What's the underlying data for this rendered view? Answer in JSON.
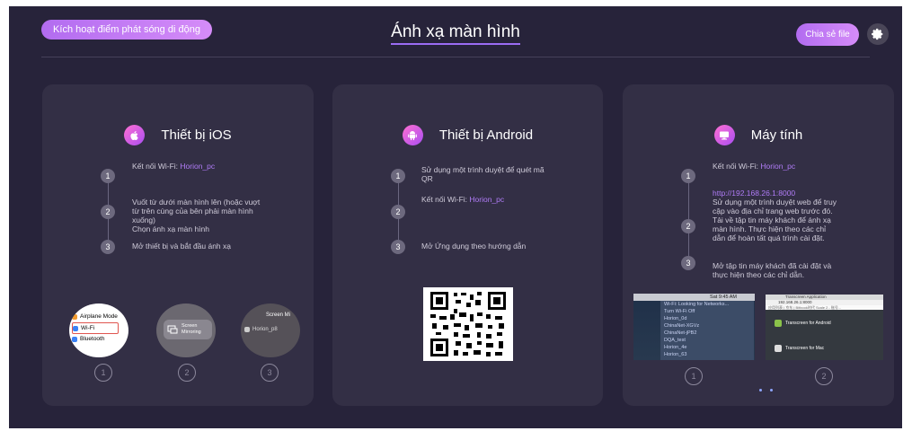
{
  "header": {
    "hotspot_label": "Kích hoạt điểm phát sóng di động",
    "title": "Ánh xạ màn hình",
    "share_label": "Chia sẻ file",
    "settings_icon": "gear-icon"
  },
  "ios": {
    "title": "Thiết bị iOS",
    "icon": "apple-icon",
    "step1_prefix": "Kết nối Wi-Fi:",
    "step1_network": "Horion_pc",
    "step2_line1": "Vuốt từ dưới màn hình lên (hoặc vuợt",
    "step2_line2": "từ trên cùng của bên phải màn hình",
    "step2_line3": "xuống)",
    "step2_line4": "Chọn ánh xạ màn hình",
    "step3": "Mở thiết bị và bắt đầu ánh xạ",
    "n1": "1",
    "n2": "2",
    "n3": "3",
    "img1": {
      "airplane": "Airplane Mode",
      "wifi": "Wi-Fi",
      "bluetooth": "Bluetooth"
    },
    "img2": {
      "line1": "Screen",
      "line2": "Mirroring"
    },
    "img3": {
      "title": "Screen Mi",
      "item": "Horion_p8"
    }
  },
  "android": {
    "title": "Thiết bị Android",
    "icon": "android-icon",
    "step1_line1": "Sử dụng một trình duyệt để quét mã",
    "step1_line2": "QR",
    "step2_prefix": "Kết nối Wi-Fi:",
    "step2_network": "Horion_pc",
    "step3": "Mở Ứng dụng theo hướng dẫn",
    "n1": "1",
    "n2": "2",
    "n3": "3",
    "qr_icon": "qr-code"
  },
  "pc": {
    "title": "Máy tính",
    "icon": "monitor-icon",
    "step1_prefix": "Kết nối Wi-Fi:",
    "step1_network": "Horion_pc",
    "step2_url": "http://192.168.26.1:8000",
    "step2_line1": "Sử dụng một trình duyệt web để truy",
    "step2_line2": "cập vào địa chỉ trang web trước đó.",
    "step2_line3": "Tải về tập tin máy khách để ánh xạ",
    "step2_line4": "màn hình. Thực hiện theo các chỉ",
    "step2_line5": "dẫn để hoàn tất quá trình cài đặt.",
    "step3_line1": "Mở tập tin máy khách đã cài đặt và",
    "step3_line2": "thực hiện theo các chỉ dẫn.",
    "n1": "1",
    "n2": "2",
    "n3": "3",
    "mac": {
      "time": "Sat 9:45 AM",
      "menu": [
        "Wi-Fi: Looking for Networks...",
        "Turn Wi-Fi Off"
      ],
      "networks": [
        "Horion_0d",
        "ChinaNet-XGVz",
        "ChinaNet-jPB2",
        "DQA_test",
        "Horion_4e",
        "Horion_63",
        "Horion_80",
        "Horion_B6"
      ]
    },
    "browser": {
      "tab": "Transcreen Application",
      "url": "192.168.26.1:8000",
      "bookmarks": "应用列表  | 京东  | Bitbook时代 Scale 2 - 账号...",
      "android_label": "Transcreen for Android",
      "mac_label": "Transcreen for Mac"
    }
  },
  "carousel_labels": {
    "c1": "1",
    "c2": "2",
    "c3": "3"
  }
}
